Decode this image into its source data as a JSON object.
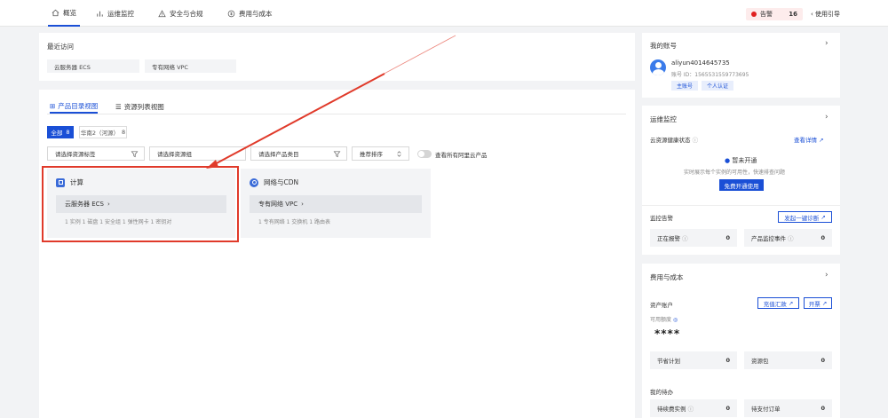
{
  "nav": {
    "tabs": [
      {
        "label": "概览",
        "active": true
      },
      {
        "label": "运维监控",
        "active": false
      },
      {
        "label": "安全与合规",
        "active": false
      },
      {
        "label": "费用与成本",
        "active": false
      }
    ],
    "alert_label": "告警",
    "alert_count": "16",
    "guide_label": "使用引导"
  },
  "recent": {
    "title": "最近访问",
    "items": [
      "云服务器 ECS",
      "专有网络 VPC"
    ]
  },
  "views": {
    "tabs": [
      "产品目录视图",
      "资源列表视图"
    ],
    "active_index": 0
  },
  "filters": {
    "all_label": "全部",
    "all_count": "8",
    "region": "华南2（河源）",
    "selects": [
      {
        "placeholder": "请选择资源标签"
      },
      {
        "placeholder": "请选择资源组"
      },
      {
        "placeholder": "请选择产品类目"
      },
      {
        "placeholder": "推荐排序"
      }
    ],
    "toggle_label": "查看所有阿里云产品",
    "toggle_on": false
  },
  "products": [
    {
      "category": "计算",
      "name": "云服务器 ECS",
      "stats": "1 实例   1 磁盘   1 安全组   1 弹性网卡   1 密钥对",
      "highlighted": true
    },
    {
      "category": "网络与CDN",
      "name": "专有网络 VPC",
      "stats": "1 专有网络   1 交换机   1 路由表",
      "highlighted": false
    }
  ],
  "account": {
    "title": "我的账号",
    "username": "aliyun4014645735",
    "account_id": "账号 ID：1565531559773695",
    "badge_main": "主账号",
    "badge_verify": "个人认证"
  },
  "ops": {
    "title": "运维监控",
    "health_label": "云资源健康状态",
    "health_link": "查看详情",
    "not_enabled": "暂未开通",
    "hint": "实时展示每个实例的可用性，快速排查问题",
    "enable_button": "免费开通使用",
    "alarm_label": "监控告警",
    "diagnose_button": "发起一键诊断",
    "metrics": [
      {
        "label": "正在报警",
        "value": "0"
      },
      {
        "label": "产品监控事件",
        "value": "0"
      }
    ]
  },
  "cost": {
    "title": "费用与成本",
    "account_label": "资产账户",
    "recharge_button": "充值汇款",
    "invoice_button": "开票",
    "credit_label": "可用额度",
    "credit_value": "****",
    "metrics": [
      {
        "label": "节省计划",
        "value": "0"
      },
      {
        "label": "资源包",
        "value": "0"
      }
    ],
    "todo_title": "我的待办",
    "todos": [
      {
        "label": "待续费实例",
        "value": "0"
      },
      {
        "label": "待支付订单",
        "value": "0"
      }
    ]
  },
  "colors": {
    "accent": "#1a4fd6",
    "highlight": "#e03a2a",
    "alert": "#e02020"
  }
}
